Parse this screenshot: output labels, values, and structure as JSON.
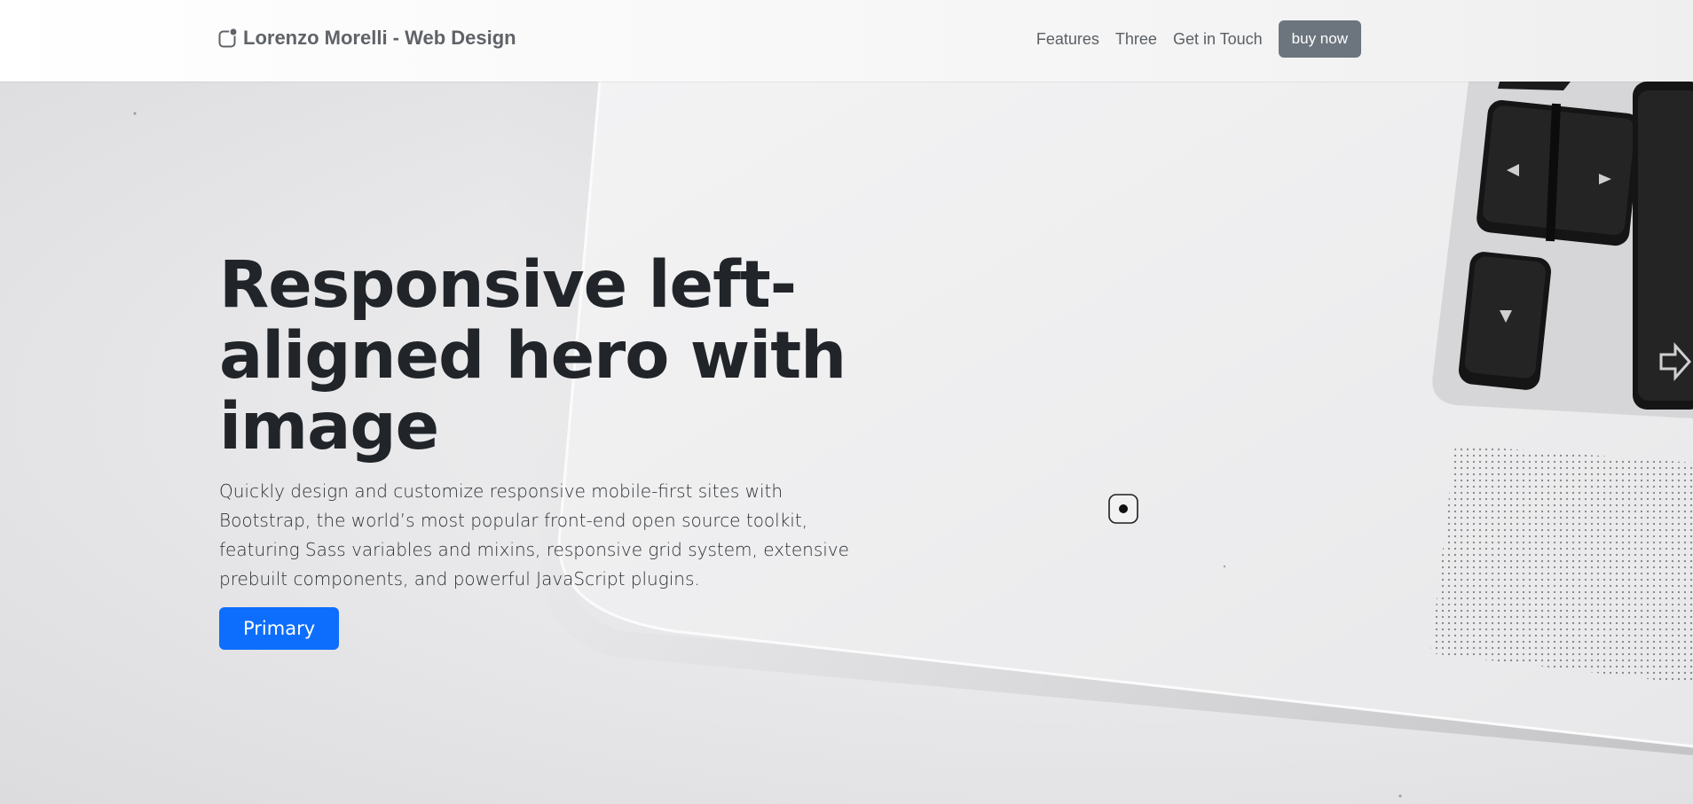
{
  "navbar": {
    "brand_text": "Lorenzo Morelli - Web Design",
    "brand_icon": "app-logo-icon",
    "links": [
      "Features",
      "Three",
      "Get in Touch"
    ],
    "buy_label": "buy now"
  },
  "hero": {
    "title": "Responsive left-aligned hero with image",
    "lead": "Quickly design and customize responsive mobile-first sites with Bootstrap, the world’s most popular front-end open source toolkit, featuring Sass variables and mixins, responsive grid system, extensive prebuilt components, and powerful JavaScript plugins.",
    "primary_label": "Primary",
    "background_image": "laptop-keyboard-photo"
  },
  "colors": {
    "primary": "#0d6efd",
    "secondary": "#6c757d",
    "text": "#212529"
  }
}
